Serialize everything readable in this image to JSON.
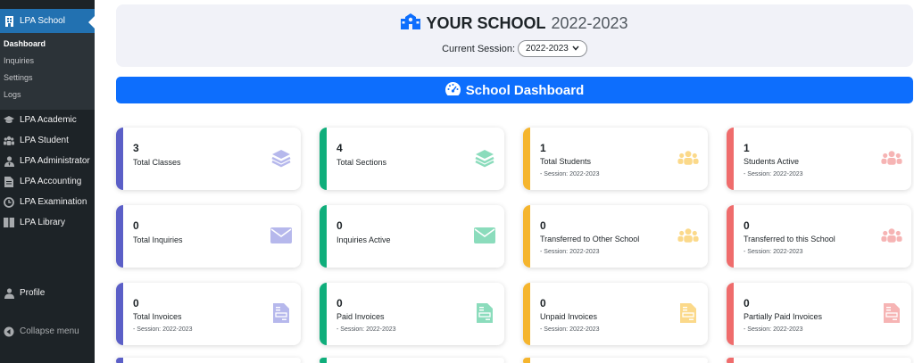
{
  "sidebar": {
    "active": "LPA School",
    "submenu": [
      "Dashboard",
      "Inquiries",
      "Settings",
      "Logs"
    ],
    "items": [
      {
        "label": "LPA Academic",
        "icon": "graduation-cap-icon"
      },
      {
        "label": "LPA Student",
        "icon": "users-icon"
      },
      {
        "label": "LPA Administrator",
        "icon": "user-tie-icon"
      },
      {
        "label": "LPA Accounting",
        "icon": "document-icon"
      },
      {
        "label": "LPA Examination",
        "icon": "clock-icon"
      },
      {
        "label": "LPA Library",
        "icon": "book-icon"
      }
    ],
    "profile": "Profile",
    "collapse": "Collapse menu"
  },
  "header": {
    "school_name": "YOUR SCHOOL",
    "year": "2022-2023",
    "session_label": "Current Session:",
    "session_value": "2022-2023"
  },
  "banner": {
    "title": "School Dashboard"
  },
  "colors": {
    "purple": "#5b5fc7",
    "green": "#0fae7b",
    "yellow": "#f5b52e",
    "red": "#ef6c6c",
    "blue": "#0d6efd"
  },
  "cards": [
    {
      "value": "3",
      "label": "Total Classes",
      "sub": "",
      "icon": "layers-icon",
      "color": "purple"
    },
    {
      "value": "4",
      "label": "Total Sections",
      "sub": "",
      "icon": "layers-icon",
      "color": "green"
    },
    {
      "value": "1",
      "label": "Total Students",
      "sub": "- Session: 2022-2023",
      "icon": "users-icon",
      "color": "yellow"
    },
    {
      "value": "1",
      "label": "Students Active",
      "sub": "- Session: 2022-2023",
      "icon": "users-icon",
      "color": "red"
    },
    {
      "value": "0",
      "label": "Total Inquiries",
      "sub": "",
      "icon": "envelope-icon",
      "color": "purple"
    },
    {
      "value": "0",
      "label": "Inquiries Active",
      "sub": "",
      "icon": "envelope-icon",
      "color": "green"
    },
    {
      "value": "0",
      "label": "Transferred to Other School",
      "sub": "- Session: 2022-2023",
      "icon": "users-icon",
      "color": "yellow"
    },
    {
      "value": "0",
      "label": "Transferred to this School",
      "sub": "- Session: 2022-2023",
      "icon": "users-icon",
      "color": "red"
    },
    {
      "value": "0",
      "label": "Total Invoices",
      "sub": "- Session: 2022-2023",
      "icon": "invoice-icon",
      "color": "purple"
    },
    {
      "value": "0",
      "label": "Paid Invoices",
      "sub": "- Session: 2022-2023",
      "icon": "invoice-icon",
      "color": "green"
    },
    {
      "value": "0",
      "label": "Unpaid Invoices",
      "sub": "- Session: 2022-2023",
      "icon": "invoice-icon",
      "color": "yellow"
    },
    {
      "value": "0",
      "label": "Partially Paid Invoices",
      "sub": "- Session: 2022-2023",
      "icon": "invoice-icon",
      "color": "red"
    }
  ]
}
